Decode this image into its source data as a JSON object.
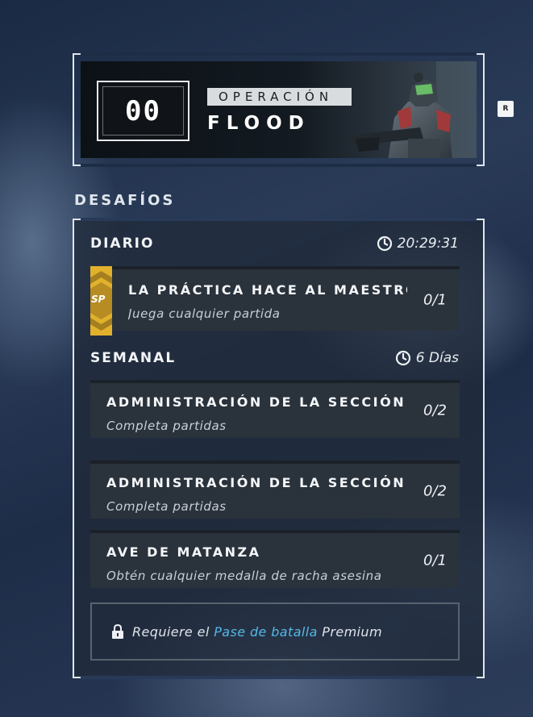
{
  "operation": {
    "rank": "00",
    "label": "OPERACIÓN",
    "name": "FLOOD",
    "key_hint": "R"
  },
  "section_title": "DESAFÍOS",
  "daily": {
    "title": "DIARIO",
    "timer": "20:29:31",
    "timer_icon": "clock-icon",
    "sp_badge": "SP",
    "challenge": {
      "title": "LA PRÁCTICA HACE AL MAESTRO",
      "description": "Juega cualquier partida",
      "progress": "0/1"
    }
  },
  "weekly": {
    "title": "SEMANAL",
    "timer": "6 Días",
    "timer_icon": "clock-icon",
    "challenges": [
      {
        "title": "ADMINISTRACIÓN DE LA SECCIÓN DE",
        "description": "Completa partidas",
        "progress": "0/2"
      },
      {
        "title": "ADMINISTRACIÓN DE LA SECCIÓN DE",
        "description": "Completa partidas",
        "progress": "0/2"
      },
      {
        "title": "AVE DE MATANZA",
        "description": "Obtén cualquier medalla de racha asesina",
        "progress": "0/1"
      }
    ]
  },
  "premium_lock": {
    "prefix": "Requiere el",
    "link": "Pase de batalla",
    "suffix": "Premium",
    "icon": "lock-icon"
  },
  "colors": {
    "accent_link": "#55b7e6",
    "sp_gold": "#e2b12c"
  }
}
